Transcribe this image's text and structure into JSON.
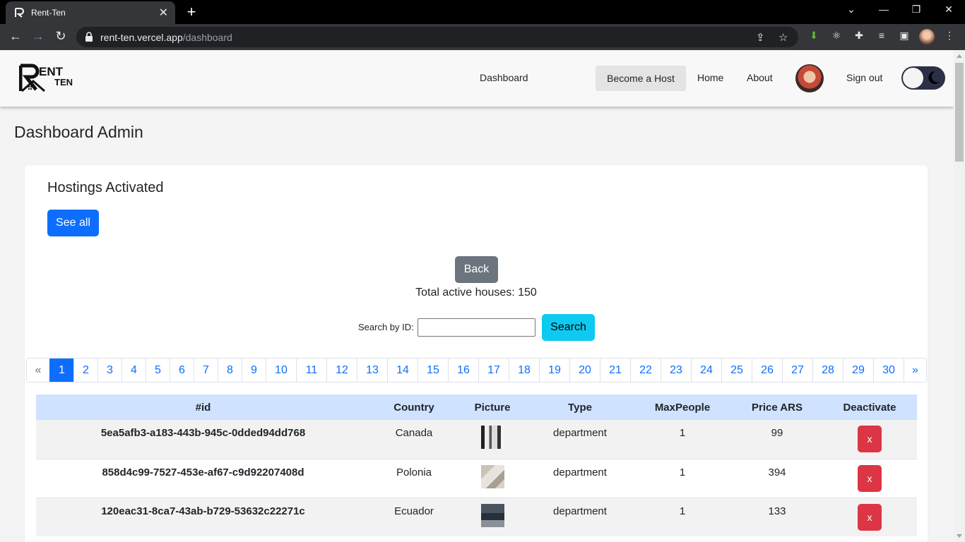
{
  "browser": {
    "tab_title": "Rent-Ten",
    "url_host": "rent-ten.vercel.app",
    "url_path": "/dashboard"
  },
  "nav": {
    "dashboard": "Dashboard",
    "become_host": "Become a Host",
    "home": "Home",
    "about": "About",
    "sign_out": "Sign out",
    "logo_text": "RENT TEN"
  },
  "page_title": "Dashboard Admin",
  "card": {
    "title": "Hostings Activated",
    "see_all": "See all",
    "back": "Back",
    "total": "Total active houses: 150",
    "search_label": "Search by ID:",
    "search_button": "Search",
    "search_value": ""
  },
  "pagination": {
    "prev": "«",
    "next": "»",
    "pages": [
      "1",
      "2",
      "3",
      "4",
      "5",
      "6",
      "7",
      "8",
      "9",
      "10",
      "11",
      "12",
      "13",
      "14",
      "15",
      "16",
      "17",
      "18",
      "19",
      "20",
      "21",
      "22",
      "23",
      "24",
      "25",
      "26",
      "27",
      "28",
      "29",
      "30"
    ],
    "active": "1"
  },
  "table": {
    "headers": [
      "#id",
      "Country",
      "Picture",
      "Type",
      "MaxPeople",
      "Price ARS",
      "Deactivate"
    ],
    "rows": [
      {
        "id": "5ea5afb3-a183-443b-945c-0dded94dd768",
        "country": "Canada",
        "type": "department",
        "max_people": "1",
        "price": "99",
        "deactivate": "x"
      },
      {
        "id": "858d4c99-7527-453e-af67-c9d92207408d",
        "country": "Polonia",
        "type": "department",
        "max_people": "1",
        "price": "394",
        "deactivate": "x"
      },
      {
        "id": "120eac31-8ca7-43ab-b729-53632c22271c",
        "country": "Ecuador",
        "type": "department",
        "max_people": "1",
        "price": "133",
        "deactivate": "x"
      }
    ]
  },
  "colors": {
    "primary": "#0d6efd",
    "secondary": "#6c757d",
    "info": "#0dcaf0",
    "danger": "#dc3545",
    "table_header": "#cfe2ff"
  }
}
